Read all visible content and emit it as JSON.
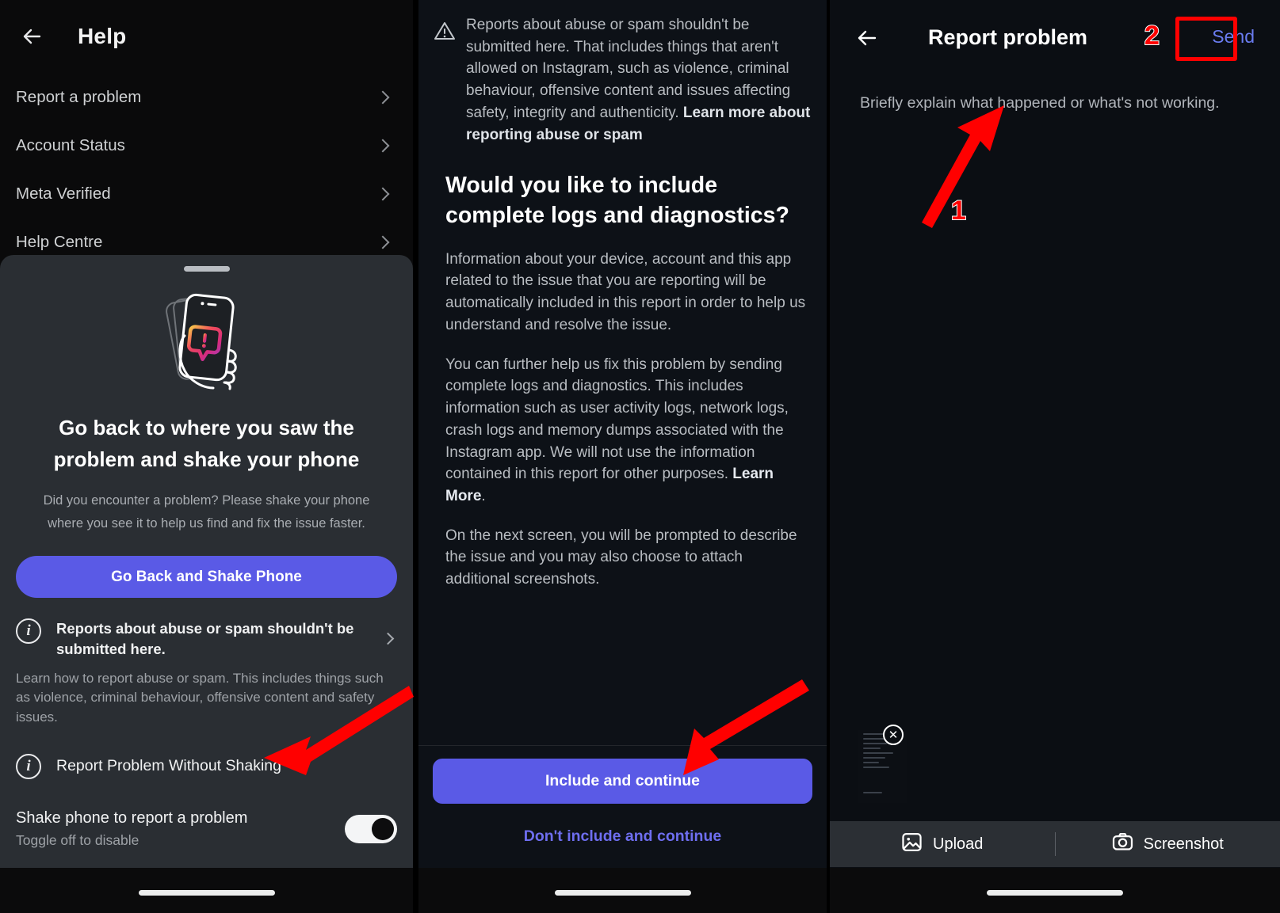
{
  "left_panel": {
    "header": {
      "title": "Help",
      "back_icon": "arrow-left-icon"
    },
    "menu": [
      {
        "label": "Report a problem"
      },
      {
        "label": "Account Status"
      },
      {
        "label": "Meta Verified"
      },
      {
        "label": "Help Centre"
      }
    ],
    "sheet": {
      "illustration": "hand-holding-phone-with-instagram-alert-icon",
      "title": "Go back to where you saw the problem and shake your phone",
      "subtitle": "Did you encounter a problem? Please shake your phone where you see it to help us find and fix the issue faster.",
      "primary_button": "Go Back and Shake Phone",
      "abuse_row_title": "Reports about abuse or spam shouldn't be submitted here.",
      "abuse_row_desc": "Learn how to report abuse or spam. This includes things such as violence, criminal behaviour, offensive content and safety issues.",
      "without_shaking_label": "Report Problem Without Shaking",
      "toggle_label": "Shake phone to report a problem",
      "toggle_sub": "Toggle off to disable",
      "toggle_state": "on"
    }
  },
  "middle_panel": {
    "warning": {
      "icon": "warning-triangle-icon",
      "body": "Reports about abuse or spam shouldn't be submitted here. That includes things that aren't allowed on Instagram, such as violence, criminal behaviour, offensive content and issues affecting safety, integrity and authenticity. ",
      "link": "Learn more about reporting abuse or spam"
    },
    "heading": "Would you like to include complete logs and diagnostics?",
    "paragraph_1": "Information about your device, account and this app related to the issue that you are reporting will be automatically included in this report in order to help us understand and resolve the issue.",
    "paragraph_2": "You can further help us fix this problem by sending complete logs and diagnostics. This includes information such as user activity logs, network logs, crash logs and memory dumps associated with the Instagram app. We will not use the information contained in this report for other purposes. ",
    "paragraph_2_link": "Learn More",
    "paragraph_2_tail": ".",
    "paragraph_3": "On the next screen, you will be prompted to describe the issue and you may also choose to attach additional screenshots.",
    "include_button": "Include and continue",
    "dont_include_button": "Don't include and continue"
  },
  "right_panel": {
    "header": {
      "title": "Report problem",
      "back_icon": "arrow-left-icon",
      "send_label": "Send"
    },
    "description_placeholder": "Briefly explain what happened or what's not working.",
    "attachment": {
      "remove_icon": "close-circle-icon"
    },
    "attach_bar": [
      {
        "label": "Upload",
        "icon": "image-icon"
      },
      {
        "label": "Screenshot",
        "icon": "camera-icon"
      }
    ]
  },
  "annotations": {
    "step_1": "1",
    "step_2": "2",
    "accent_color": "#ff0000"
  },
  "colors": {
    "accent_blue": "#5a5ae6",
    "link_blue": "#6e6ef0",
    "send_blue": "#6a7cf0",
    "panel_dark": "#0d1117",
    "sheet_gray": "#2a2e33",
    "annotation_red": "#ff0000"
  }
}
